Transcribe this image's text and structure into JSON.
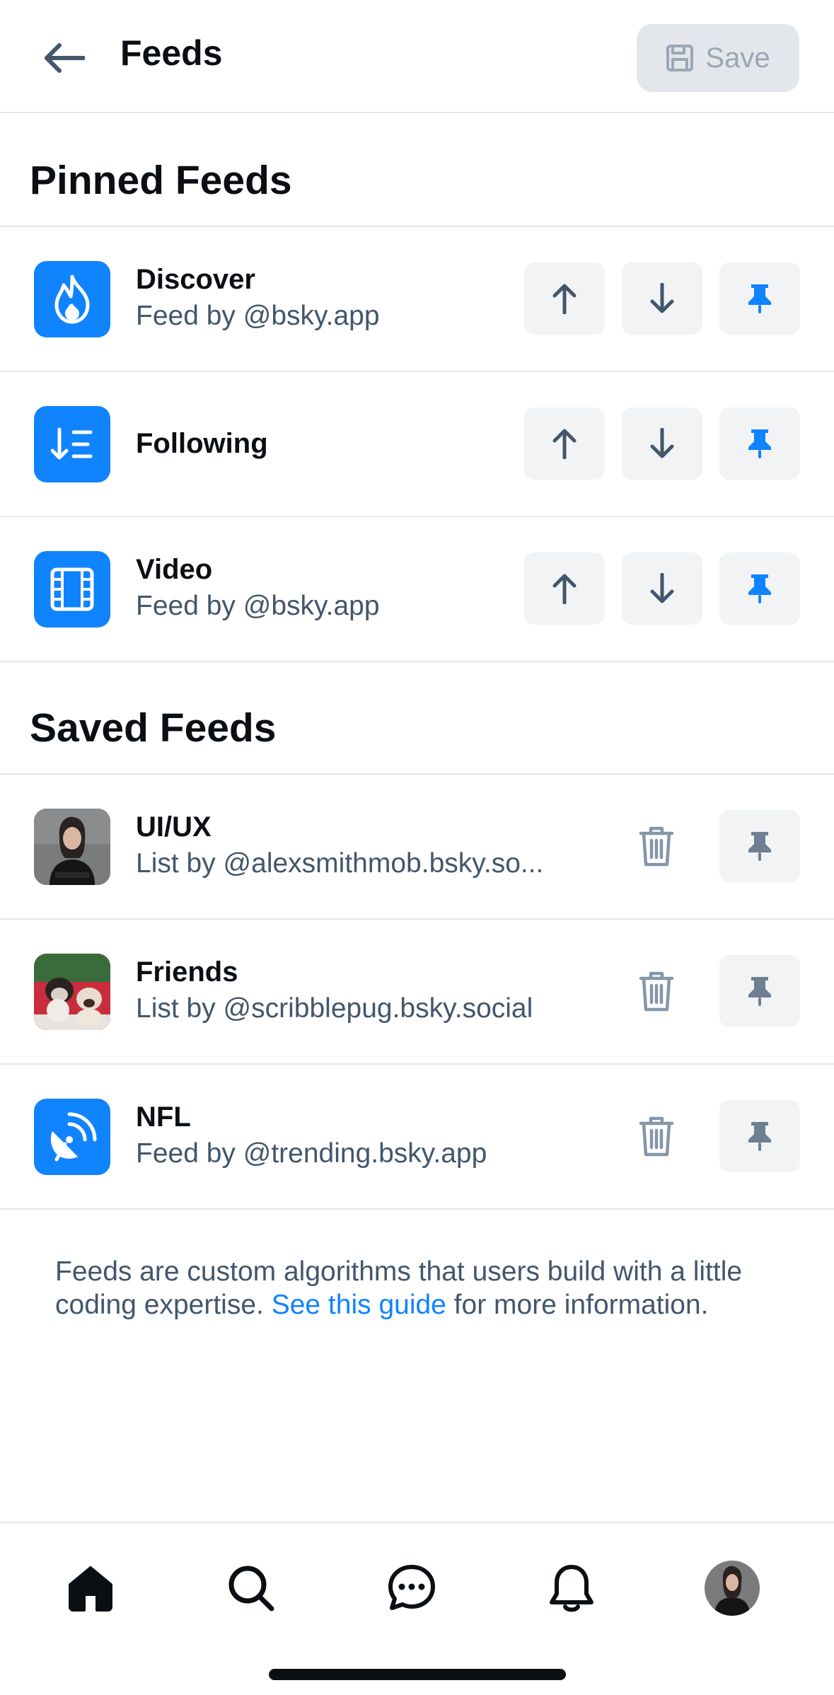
{
  "header": {
    "title": "Feeds",
    "save_label": "Save"
  },
  "pinned": {
    "title": "Pinned Feeds",
    "items": [
      {
        "name": "Discover",
        "sub": "Feed by @bsky.app",
        "icon": "flame-icon"
      },
      {
        "name": "Following",
        "sub": "",
        "icon": "sort-list-icon"
      },
      {
        "name": "Video",
        "sub": "Feed by @bsky.app",
        "icon": "film-icon"
      }
    ]
  },
  "saved": {
    "title": "Saved Feeds",
    "items": [
      {
        "name": "UI/UX",
        "sub": "List by @alexsmithmob.bsky.so...",
        "icon": "profile-photo"
      },
      {
        "name": "Friends",
        "sub": "List by @scribblepug.bsky.social",
        "icon": "dogs-photo"
      },
      {
        "name": "NFL",
        "sub": "Feed by @trending.bsky.app",
        "icon": "satellite-dish-icon"
      }
    ]
  },
  "info": {
    "text_before": "Feeds are custom algorithms that users build with a little coding expertise. ",
    "link": "See this guide",
    "text_after": " for more information."
  },
  "nav": [
    "home-icon",
    "search-icon",
    "chat-icon",
    "bell-icon",
    "profile-avatar"
  ],
  "colors": {
    "accent": "#1083fe",
    "muted": "#42566c",
    "control_bg": "#f1f3f5",
    "divider": "#e3e7ec"
  }
}
